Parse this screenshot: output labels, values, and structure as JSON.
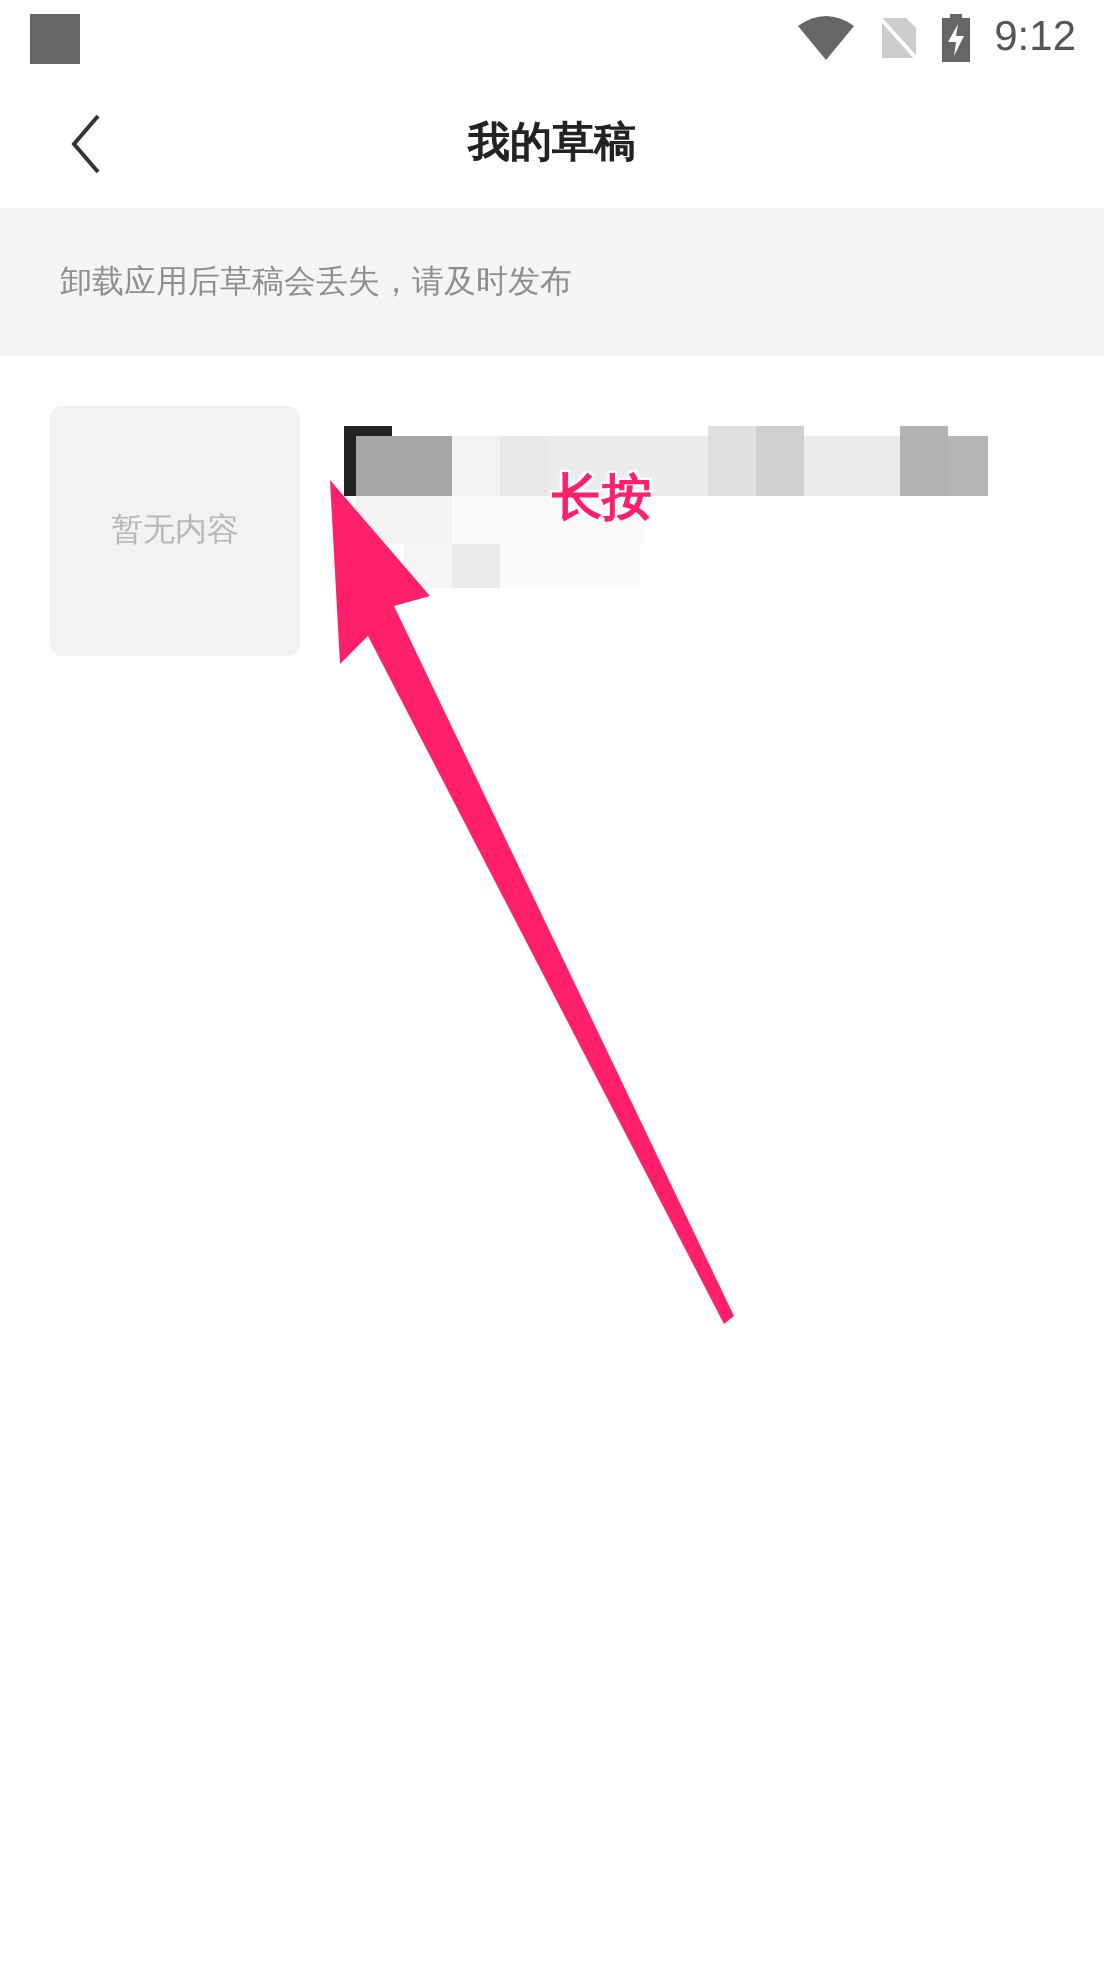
{
  "status_bar": {
    "time": "9:12"
  },
  "header": {
    "title": "我的草稿"
  },
  "notice": "卸载应用后草稿会丢失，请及时发布",
  "drafts": [
    {
      "thumbnail_text": "暂无内容"
    }
  ],
  "annotation": {
    "text": "长按"
  }
}
